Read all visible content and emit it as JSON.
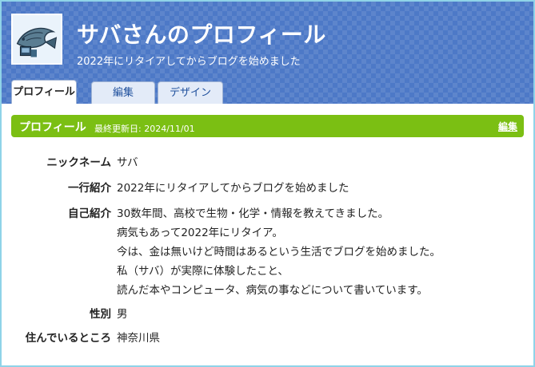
{
  "header": {
    "title": "サバさんのプロフィール",
    "subtitle": "2022年にリタイアしてからブログを始めました"
  },
  "tabs": [
    {
      "label": "プロフィール",
      "active": true
    },
    {
      "label": "編集",
      "active": false
    },
    {
      "label": "デザイン",
      "active": false
    }
  ],
  "section": {
    "title": "プロフィール",
    "updated": "最終更新日: 2024/11/01",
    "edit_link": "編集"
  },
  "profile": {
    "nickname": {
      "label": "ニックネーム",
      "value": "サバ"
    },
    "intro": {
      "label": "一行紹介",
      "value": "2022年にリタイアしてからブログを始めました"
    },
    "bio": {
      "label": "自己紹介",
      "lines": [
        "30数年間、高校で生物・化学・情報を教えてきました。",
        "病気もあって2022年にリタイア。",
        "今は、金は無いけど時間はあるという生活でブログを始めました。",
        "私（サバ）が実際に体験したこと、",
        "読んだ本やコンピュータ、病気の事などについて書いています。"
      ]
    },
    "gender": {
      "label": "性別",
      "value": "男"
    },
    "residence": {
      "label": "住んでいるところ",
      "value": "神奈川県"
    }
  },
  "colors": {
    "header_bg": "#4d79c7",
    "section_bar": "#7bbf13",
    "frame_border": "#8fd3e8"
  },
  "icons": [
    "fish-avatar-icon"
  ]
}
